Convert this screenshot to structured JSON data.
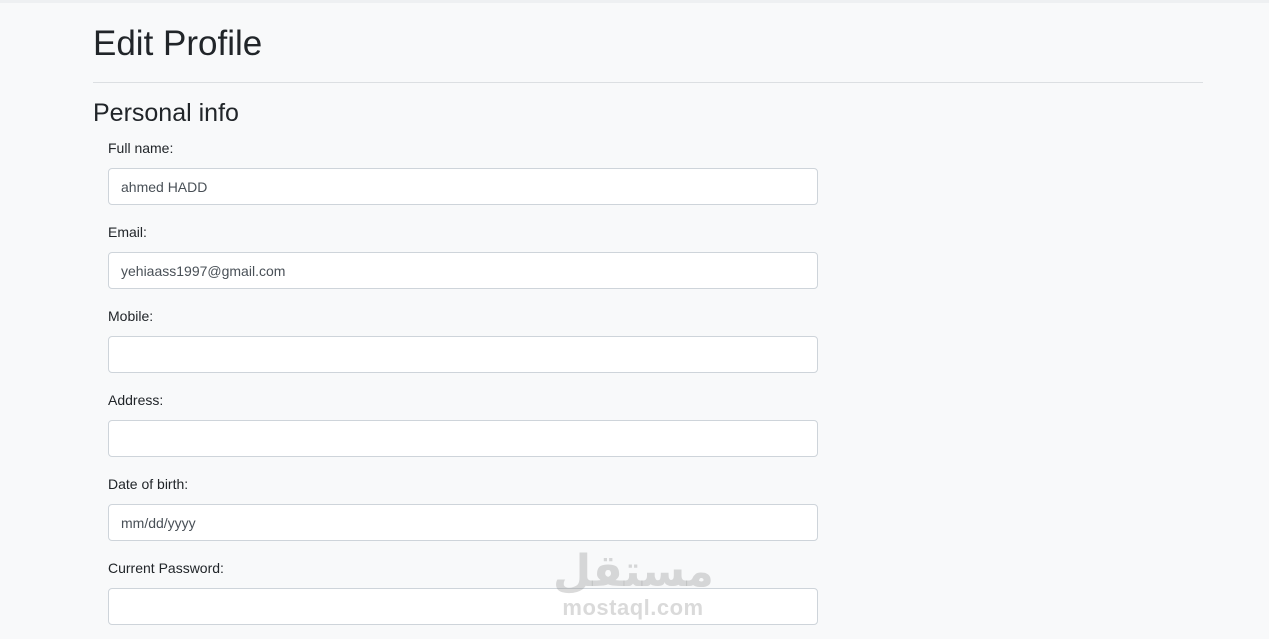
{
  "page": {
    "title": "Edit Profile",
    "section_title": "Personal info"
  },
  "form": {
    "full_name": {
      "label": "Full name:",
      "value": "ahmed HADD",
      "placeholder": ""
    },
    "email": {
      "label": "Email:",
      "value": "yehiaass1997@gmail.com",
      "placeholder": ""
    },
    "mobile": {
      "label": "Mobile:",
      "value": "",
      "placeholder": ""
    },
    "address": {
      "label": "Address:",
      "value": "",
      "placeholder": ""
    },
    "dob": {
      "label": "Date of birth:",
      "value": "",
      "placeholder": "mm/dd/yyyy"
    },
    "current_password": {
      "label": "Current Password:",
      "value": "",
      "placeholder": ""
    }
  },
  "watermark": {
    "arabic": "مستقل",
    "latin": "mostaql.com"
  },
  "colors": {
    "background": "#f8f9fa",
    "input_border": "#ced4da",
    "text": "#212529"
  }
}
